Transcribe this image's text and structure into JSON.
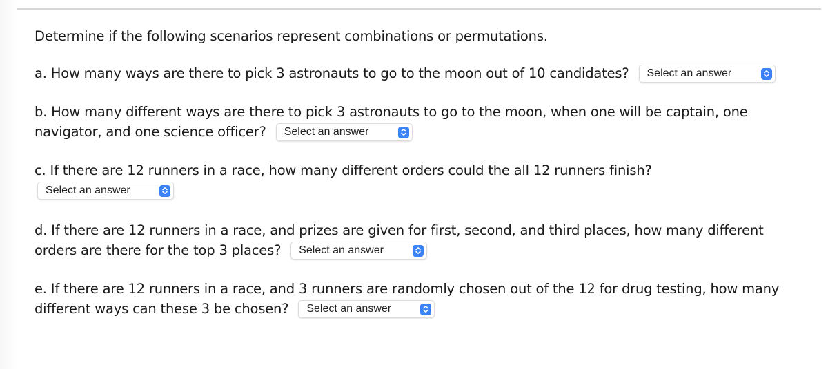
{
  "page": {
    "instructions": "Determine if the following scenarios represent combinations or permutations."
  },
  "questions": [
    {
      "id": "a",
      "text": "a. How many ways are there to pick 3 astronauts to go to the moon out of 10 candidates?",
      "select": {
        "selected": "Select an answer",
        "icon": "up-down-chevron-icon"
      }
    },
    {
      "id": "b",
      "text": "b. How many different ways are there to pick 3 astronauts to go to the moon, when one will be captain, one navigator, and one science officer?",
      "select": {
        "selected": "Select an answer",
        "icon": "up-down-chevron-icon"
      }
    },
    {
      "id": "c",
      "text": "c. If there are 12 runners in a race, how many different orders could the all 12 runners finish?",
      "select": {
        "selected": "Select an answer",
        "icon": "up-down-chevron-icon"
      }
    },
    {
      "id": "d",
      "text": "d. If there are 12 runners in a race, and prizes are given for first, second, and third places, how many different orders are there for the top 3 places?",
      "select": {
        "selected": "Select an answer",
        "icon": "up-down-chevron-icon"
      }
    },
    {
      "id": "e",
      "text": "e. If there are 12 runners in a race, and 3 runners are randomly chosen out of the 12 for drug testing, how many different ways can these 3 be chosen?",
      "select": {
        "selected": "Select an answer",
        "icon": "up-down-chevron-icon"
      }
    }
  ],
  "colors": {
    "accent": "#3b82f6",
    "text": "#1a1a1a",
    "divider": "#d6d6d6"
  }
}
